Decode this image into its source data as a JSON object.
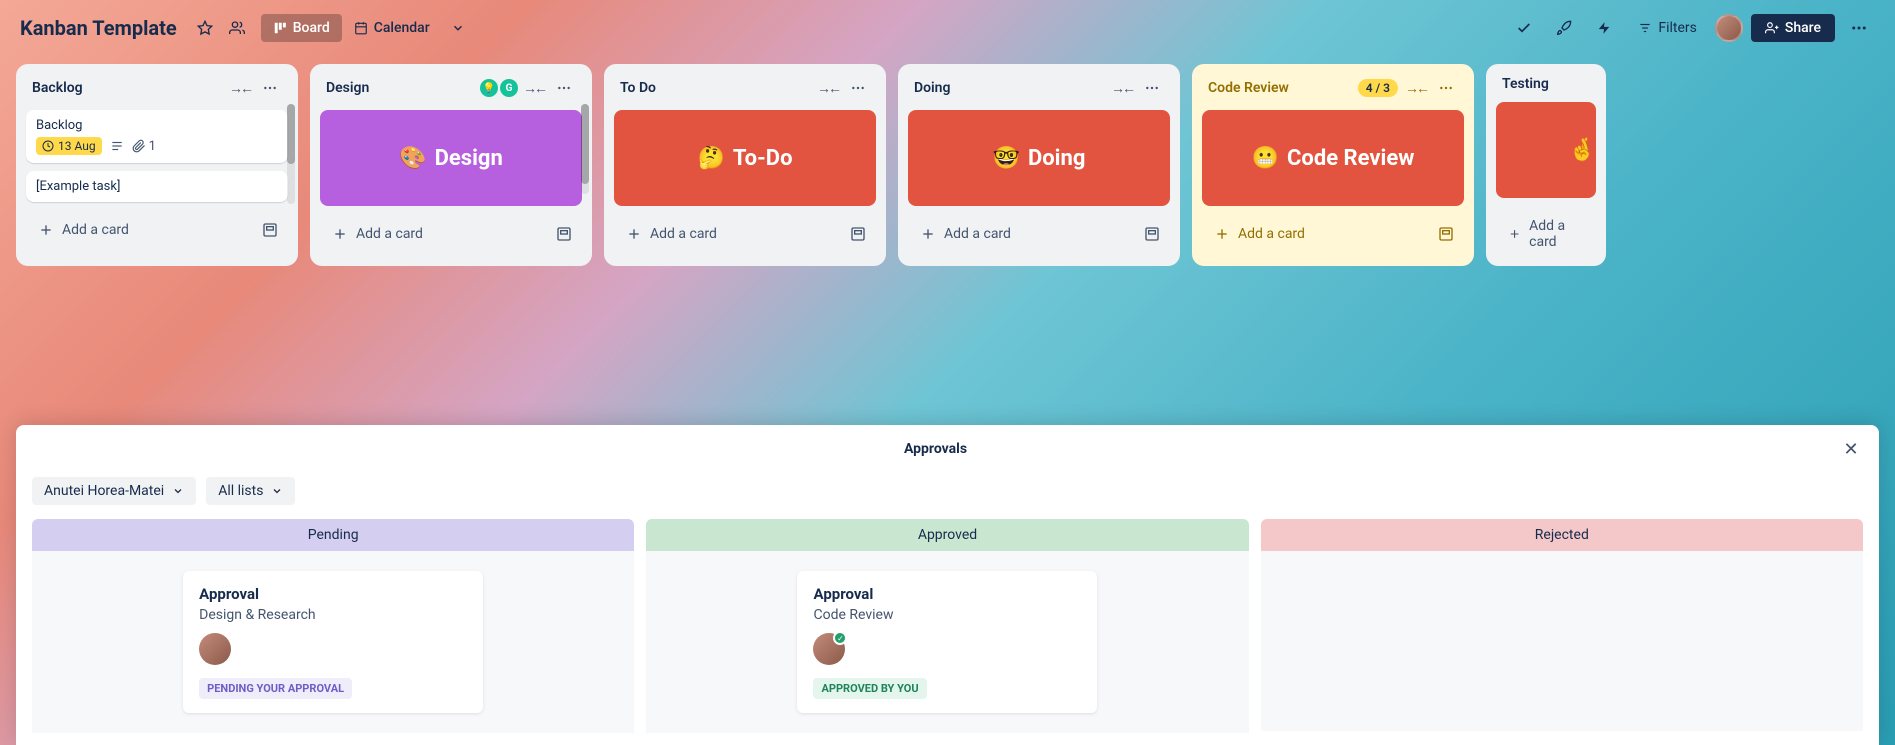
{
  "header": {
    "title": "Kanban Template",
    "views": {
      "board": "Board",
      "calendar": "Calendar"
    },
    "filters": "Filters",
    "share": "Share"
  },
  "lists": [
    {
      "title": "Backlog",
      "cards": [
        {
          "title": "Backlog",
          "date": "13 Aug",
          "attachments": "1"
        },
        {
          "title": "[Example task]"
        }
      ],
      "addLabel": "Add a card"
    },
    {
      "title": "Design",
      "cover": {
        "emoji": "🎨",
        "text": "Design",
        "color": "purple"
      },
      "grammarly": true,
      "addLabel": "Add a card"
    },
    {
      "title": "To Do",
      "cover": {
        "emoji": "🤔",
        "text": "To-Do",
        "color": "red"
      },
      "addLabel": "Add a card"
    },
    {
      "title": "Doing",
      "cover": {
        "emoji": "🤓",
        "text": "Doing",
        "color": "red"
      },
      "addLabel": "Add a card"
    },
    {
      "title": "Code Review",
      "badge": "4 / 3",
      "highlighted": true,
      "cover": {
        "emoji": "😬",
        "text": "Code Review",
        "color": "red"
      },
      "addLabel": "Add a card"
    },
    {
      "title": "Testing",
      "cover": {
        "emoji": "🤞",
        "text": "",
        "color": "red"
      },
      "addLabel": "Add a card",
      "cutoff": true
    }
  ],
  "approvals": {
    "title": "Approvals",
    "filters": {
      "user": "Anutei Horea-Matei",
      "list": "All lists"
    },
    "columns": {
      "pending": {
        "label": "Pending",
        "card": {
          "title": "Approval",
          "sub": "Design & Research",
          "status": "PENDING YOUR APPROVAL"
        }
      },
      "approved": {
        "label": "Approved",
        "card": {
          "title": "Approval",
          "sub": "Code Review",
          "status": "APPROVED BY YOU",
          "check": true
        }
      },
      "rejected": {
        "label": "Rejected"
      }
    }
  }
}
